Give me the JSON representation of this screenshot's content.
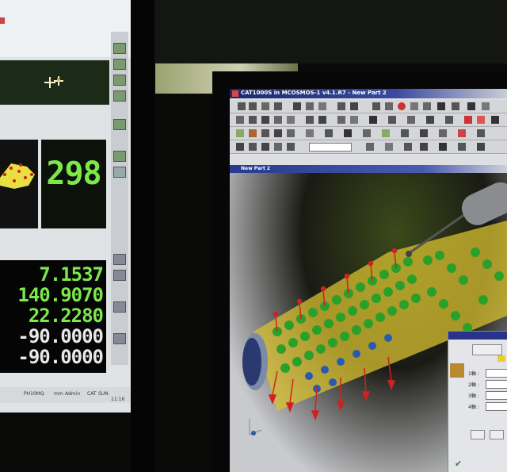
{
  "left_monitor": {
    "count_display": "298",
    "readouts": [
      {
        "value": "7.1537",
        "color": "#7de84a"
      },
      {
        "value": "140.9070",
        "color": "#7de84a"
      },
      {
        "value": "22.2280",
        "color": "#7de84a"
      },
      {
        "value": "-90.0000",
        "color": "#e8e8e8"
      },
      {
        "value": "-90.0000",
        "color": "#e8e8e8"
      }
    ],
    "status_bar": {
      "item1": "PH10MQ",
      "item2": "mm",
      "item3": "Admin",
      "item4": "CAT",
      "item5": "SUN",
      "time": "11:16"
    }
  },
  "right_monitor": {
    "window_title": "CAT1000S in MCOSMOS-1 v4.1.R7 - New Part 2",
    "document_title": "New Part 2",
    "dialog": {
      "labels": [
        "1軸 :",
        "2軸 :",
        "3軸 :",
        "4軸 :"
      ]
    }
  },
  "colors": {
    "lcd_green": "#7de84a",
    "title_blue": "#27348a"
  }
}
